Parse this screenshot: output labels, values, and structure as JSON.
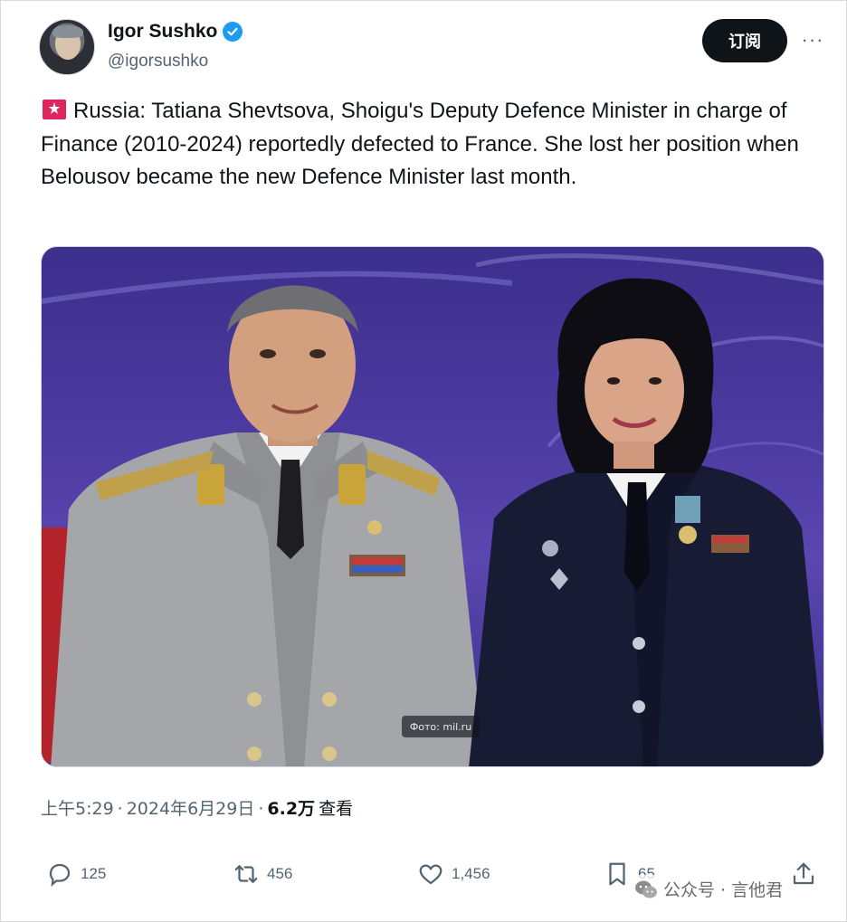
{
  "author": {
    "display_name": "Igor Sushko",
    "handle": "@igorsushko",
    "verified": true
  },
  "header": {
    "subscribe_label": "订阅",
    "more_label": "···"
  },
  "tweet": {
    "emoji": "rotating-light",
    "text": "Russia: Tatiana Shevtsova, Shoigu's Deputy Defence Minister in charge of Finance (2010-2024) reportedly defected to France. She lost her position when Belousov became the new Defence Minister last month."
  },
  "media": {
    "credit": "Фото: mil.ru"
  },
  "meta": {
    "time": "上午5:29",
    "separator": "·",
    "date": "2024年6月29日",
    "separator2": "·",
    "views_count": "6.2万",
    "views_label": "查看"
  },
  "actions": {
    "replies": "125",
    "reposts": "456",
    "likes": "1,456",
    "bookmarks": "65"
  },
  "watermark": {
    "text": "公众号 · 言他君"
  },
  "colors": {
    "accent": "#1d9bf0",
    "text_primary": "#0f1419",
    "text_secondary": "#536471",
    "button_bg": "#0f1419"
  }
}
